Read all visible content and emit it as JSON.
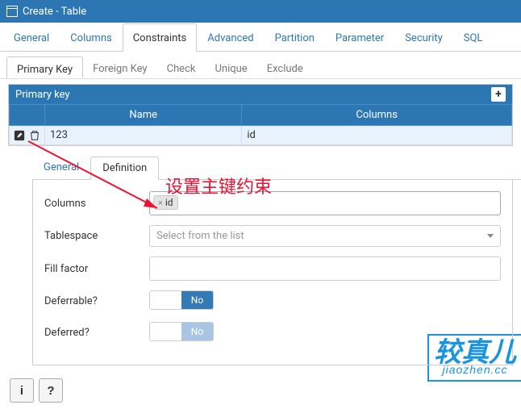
{
  "window": {
    "title": "Create - Table"
  },
  "main_tabs": [
    "General",
    "Columns",
    "Constraints",
    "Advanced",
    "Partition",
    "Parameter",
    "Security",
    "SQL"
  ],
  "main_active": 2,
  "sub_tabs": [
    "Primary Key",
    "Foreign Key",
    "Check",
    "Unique",
    "Exclude"
  ],
  "sub_active": 0,
  "pk_section": {
    "title": "Primary key",
    "add_symbol": "+",
    "col_name": "Name",
    "col_columns": "Columns",
    "rows": [
      {
        "name": "123",
        "columns": "id"
      }
    ]
  },
  "inner_tabs": [
    "General",
    "Definition"
  ],
  "inner_active": 1,
  "form": {
    "columns_label": "Columns",
    "columns_tag": "id",
    "columns_tag_x": "×",
    "tablespace_label": "Tablespace",
    "tablespace_placeholder": "Select from the list",
    "fillfactor_label": "Fill factor",
    "deferrable_label": "Deferrable?",
    "deferrable_value": "No",
    "deferred_label": "Deferred?",
    "deferred_value": "No"
  },
  "annotation_text": "设置主键约束",
  "watermark": {
    "main": "较真儿",
    "sub": "jiaozhen.cc"
  },
  "footer": {
    "info": "i",
    "help": "?"
  }
}
